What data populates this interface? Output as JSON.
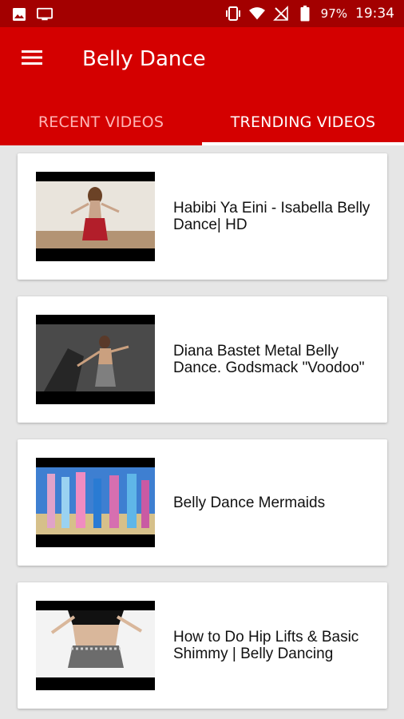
{
  "status_bar": {
    "battery_percent": "97%",
    "time": "19:34",
    "icons": [
      "image-icon",
      "cast-icon",
      "vibrate-icon",
      "wifi-icon",
      "no-signal-icon",
      "battery-icon"
    ]
  },
  "app_bar": {
    "title": "Belly Dance",
    "menu_icon": "hamburger-menu-icon",
    "background": "#d40000"
  },
  "tabs": [
    {
      "label": "RECENT VIDEOS",
      "active": false
    },
    {
      "label": "TRENDING VIDEOS",
      "active": true
    }
  ],
  "videos": [
    {
      "title": "Habibi Ya Eini - Isabella Belly Dance| HD"
    },
    {
      "title": "Diana Bastet Metal Belly Dance. Godsmack \"Voodoo\""
    },
    {
      "title": "Belly Dance Mermaids"
    },
    {
      "title": "How to Do Hip Lifts & Basic Shimmy | Belly Dancing"
    }
  ]
}
